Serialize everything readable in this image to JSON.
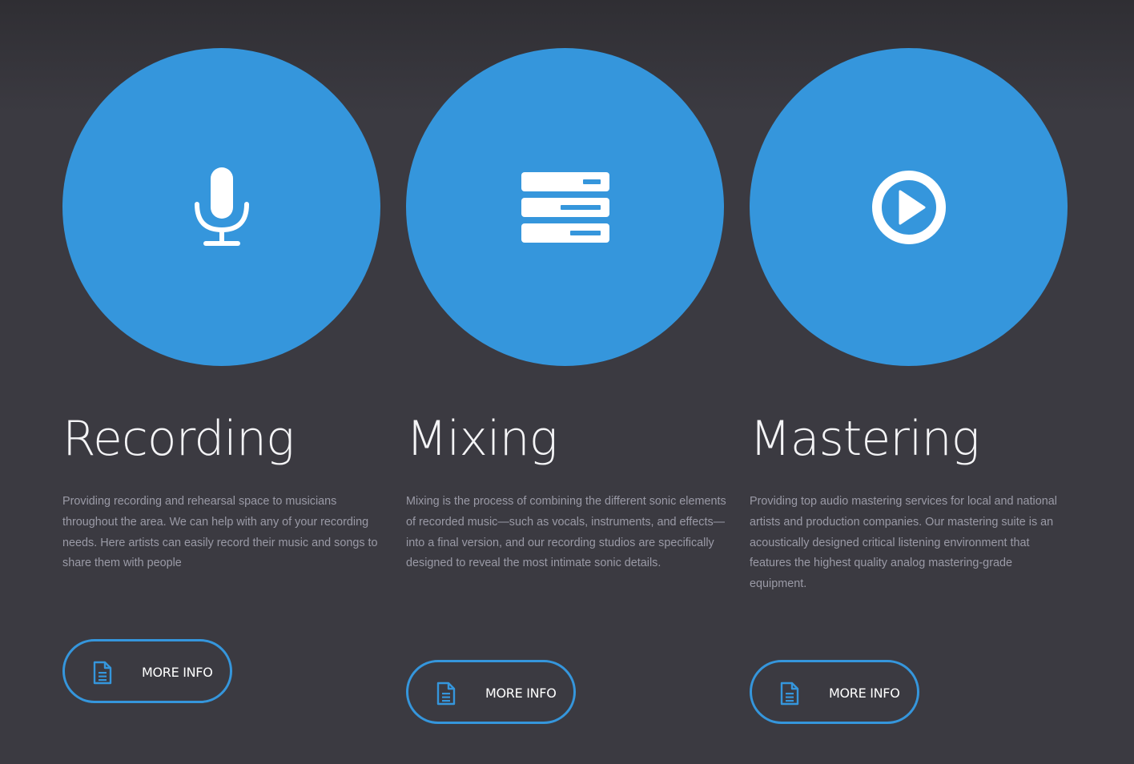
{
  "theme": {
    "background": "#3b3a41",
    "accent": "#3596dc",
    "title_color": "#f4f4f6",
    "text_color": "#9a9aa6"
  },
  "services": [
    {
      "icon": "microphone-icon",
      "title": "Recording",
      "description": "Providing recording and rehearsal space to musicians throughout the area. We can help with any of your recording needs. Here artists can easily record their music and songs to share them with people",
      "button_label": "MORE INFO",
      "button_icon": "document-icon"
    },
    {
      "icon": "server-stack-icon",
      "title": "Mixing",
      "description": "Mixing is the process of combining the different sonic elements of recorded music—such as vocals, instruments, and effects—into a final version, and our recording studios are specifically designed to reveal the most intimate sonic details.",
      "button_label": "MORE INFO",
      "button_icon": "document-icon"
    },
    {
      "icon": "play-circle-icon",
      "title": "Mastering",
      "description": "Providing top audio mastering services for local and national artists and production companies. Our mastering suite is an acoustically designed critical listening environment that features the highest quality analog mastering-grade equipment.",
      "button_label": "MORE INFO",
      "button_icon": "document-icon"
    }
  ]
}
